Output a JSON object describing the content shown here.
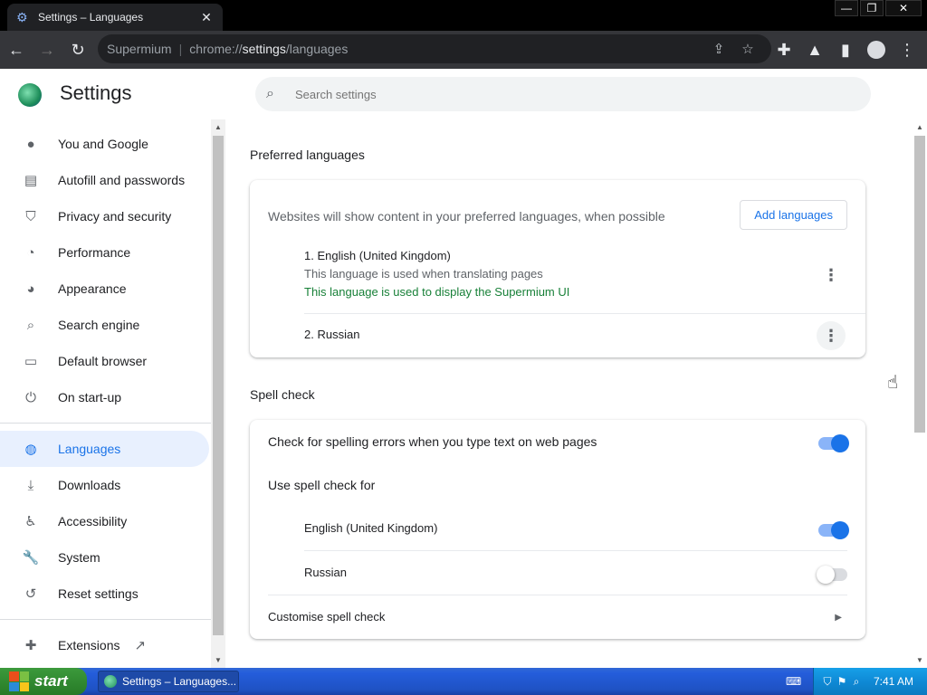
{
  "window": {
    "tab_title": "Settings – Languages",
    "minimize": "—",
    "restore": "❐",
    "close": "✕"
  },
  "toolbar": {
    "site_name": "Supermium",
    "separator": "|",
    "url_prefix": "chrome://",
    "url_host": "settings",
    "url_path": "/languages"
  },
  "header": {
    "title": "Settings",
    "search_placeholder": "Search settings"
  },
  "sidebar": {
    "items": [
      {
        "label": "You and Google",
        "icon": "person-icon"
      },
      {
        "label": "Autofill and passwords",
        "icon": "clipboard-icon"
      },
      {
        "label": "Privacy and security",
        "icon": "shield-icon"
      },
      {
        "label": "Performance",
        "icon": "speedometer-icon"
      },
      {
        "label": "Appearance",
        "icon": "palette-icon"
      },
      {
        "label": "Search engine",
        "icon": "search-icon"
      },
      {
        "label": "Default browser",
        "icon": "browser-icon"
      },
      {
        "label": "On start-up",
        "icon": "power-icon"
      }
    ],
    "items2": [
      {
        "label": "Languages",
        "icon": "globe-icon",
        "active": true
      },
      {
        "label": "Downloads",
        "icon": "download-icon"
      },
      {
        "label": "Accessibility",
        "icon": "accessibility-icon"
      },
      {
        "label": "System",
        "icon": "wrench-icon"
      },
      {
        "label": "Reset settings",
        "icon": "history-icon"
      }
    ],
    "extensions_label": "Extensions"
  },
  "preferred_languages": {
    "title": "Preferred languages",
    "description": "Websites will show content in your preferred languages, when possible",
    "add_button": "Add languages",
    "languages": [
      {
        "name": "1. English (United Kingdom)",
        "note1": "This language is used when translating pages",
        "note2": "This language is used to display the Supermium UI"
      },
      {
        "name": "2. Russian"
      }
    ]
  },
  "spell_check": {
    "title": "Spell check",
    "check_label": "Check for spelling errors when you type text on web pages",
    "check_enabled": true,
    "use_for_label": "Use spell check for",
    "languages": [
      {
        "name": "English (United Kingdom)",
        "enabled": true
      },
      {
        "name": "Russian",
        "enabled": false
      }
    ],
    "customise_label": "Customise spell check"
  },
  "taskbar": {
    "start_label": "start",
    "task_label": "Settings – Languages...",
    "time": "7:41 AM"
  },
  "colors": {
    "accent": "#1a73e8",
    "active_nav_bg": "#e8f0fe",
    "green_note": "#188038"
  }
}
